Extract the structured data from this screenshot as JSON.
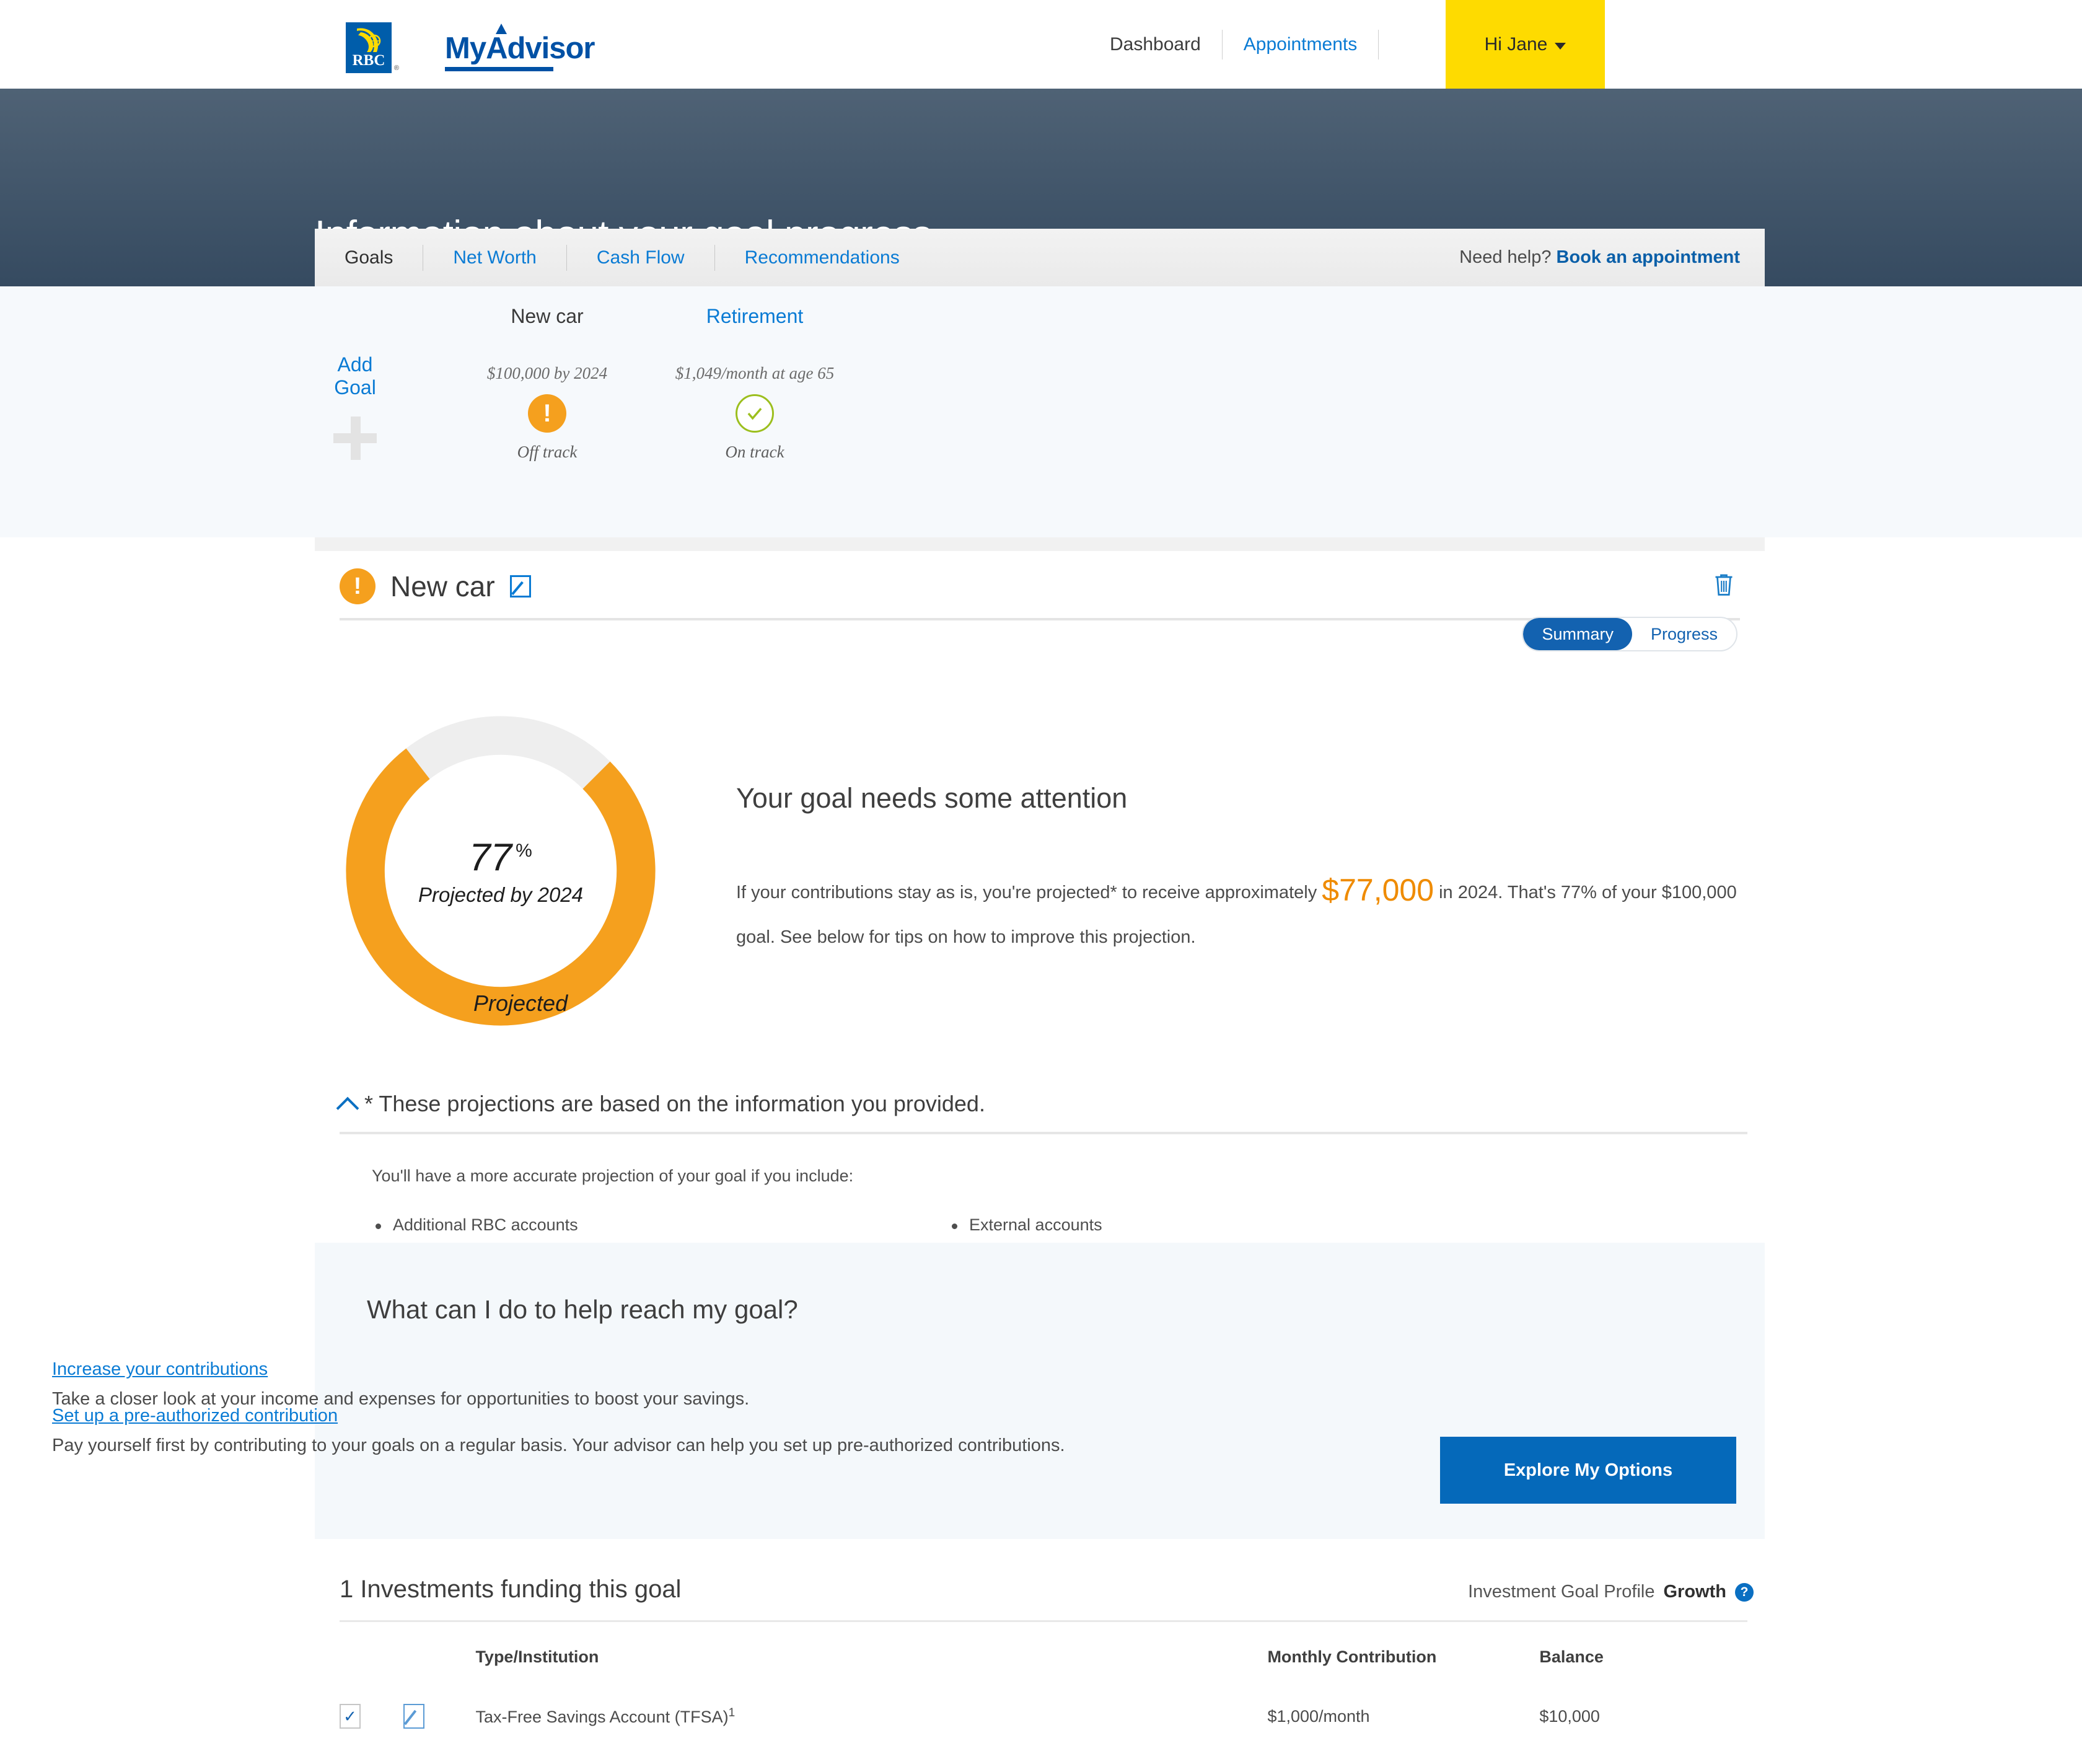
{
  "topnav": {
    "brand": {
      "rbc": "RBC",
      "myadvisor": "MyAdvisor",
      "registered": "®"
    },
    "links": [
      {
        "label": "Dashboard",
        "style": "plain"
      },
      {
        "label": "Appointments",
        "style": "link"
      }
    ],
    "greeting": "Hi Jane"
  },
  "header": {
    "title": "Information about your goal progress"
  },
  "tabs": {
    "items": [
      {
        "label": "Goals",
        "active": true
      },
      {
        "label": "Net Worth",
        "active": false
      },
      {
        "label": "Cash Flow",
        "active": false
      },
      {
        "label": "Recommendations",
        "active": false
      }
    ],
    "help_text": "Need help?",
    "help_link": "Book an appointment"
  },
  "goals_strip": {
    "add_goal_label": "Add Goal",
    "goals": [
      {
        "title": "New car",
        "subtitle": "$100,000 by 2024",
        "status": "Off track",
        "status_type": "warning",
        "icon": "exclamation-icon",
        "selected": true
      },
      {
        "title": "Retirement",
        "subtitle": "$1,049/month at age 65",
        "status": "On track",
        "status_type": "ok",
        "icon": "check-icon",
        "selected": false
      }
    ]
  },
  "goal_card": {
    "badge": "!",
    "title": "New car",
    "edit_icon": "edit-pencil-icon",
    "delete_icon": "trash-icon",
    "view_toggle": {
      "options": [
        "Summary",
        "Progress"
      ],
      "selected": "Summary"
    }
  },
  "chart_data": {
    "type": "pie",
    "title": "Projected by 2024",
    "center_value": "77",
    "center_unit": "%",
    "center_caption": "Projected by 2024",
    "categories": [
      "Projected",
      "Remaining"
    ],
    "values": [
      77,
      23
    ],
    "colors": [
      "#f5a01e",
      "#eeeeee"
    ],
    "legend": [
      {
        "label": "Projected",
        "color": "#f5a01e"
      }
    ],
    "legend_position": "bottom-left",
    "donut": true
  },
  "summary": {
    "heading": "Your goal needs some attention",
    "body_part1": "If your contributions stay as is, you're projected* to receive approximately ",
    "amount": "$77,000",
    "body_part2": " in 2024. That's 77% of your $100,000 goal. See below for tips on how to improve this projection."
  },
  "disclosure": {
    "title": "* These projections are based on the information you provided.",
    "chevron": "chevron-up-icon",
    "lead": "You'll have a more accurate projection of your goal if you include:",
    "items": [
      "Additional RBC accounts",
      "External accounts"
    ]
  },
  "help_panel": {
    "title": "What can I do to help reach my goal?",
    "tips": [
      {
        "link": "Increase your contributions",
        "desc": "Take a closer look at your income and expenses for opportunities to boost your savings."
      },
      {
        "link": "Set up a pre-authorized contribution",
        "desc": "Pay yourself first by contributing to your goals on a regular basis. Your advisor can help you set up pre-authorized contributions."
      }
    ],
    "cta": "Explore My Options"
  },
  "investments": {
    "title": "1 Investments funding this goal",
    "profile_label": "Investment Goal Profile",
    "profile_value": "Growth",
    "help_icon": "question-mark-icon",
    "columns": [
      "Type/Institution",
      "Monthly Contribution",
      "Balance"
    ],
    "rows": [
      {
        "checked": true,
        "type": "Tax-Free Savings Account (TFSA)",
        "footnote": "1",
        "contribution": "$1,000/month",
        "balance": "$10,000"
      }
    ]
  },
  "colors": {
    "brand_blue": "#005daa",
    "link_blue": "#0a7bd4",
    "accent_yellow": "#fedb00",
    "warning_orange": "#f5a01e",
    "ok_green": "#9cbf1e",
    "header_dark": "#3c5066",
    "cta_blue": "#0569ba"
  }
}
